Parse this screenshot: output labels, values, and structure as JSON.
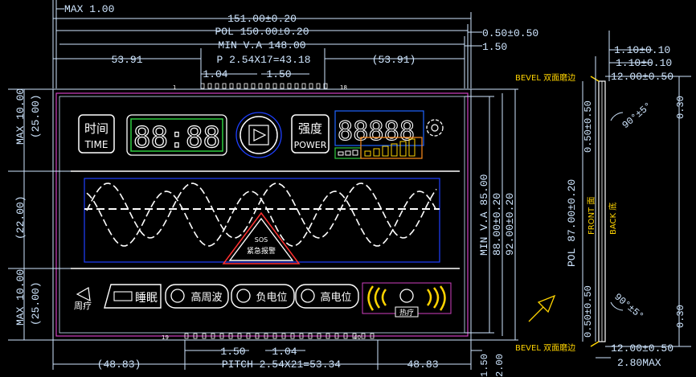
{
  "dimensions": {
    "max_top": "MAX 1.00",
    "total_width": "151.00±0.20",
    "pol_width": "POL 150.00±0.20",
    "min_va_width": "MIN V.A 148.00",
    "left_offset": "53.91",
    "pin_pitch_top": "P 2.54X17=43.18",
    "right_offset_top": "(53.91)",
    "pin_width_top": "1.04",
    "pin_gap_top": "1.50",
    "pol_right": "0.50±0.50",
    "va_right": "1.50",
    "left_max_top": "MAX 10.00",
    "left_25_top": "(25.00)",
    "left_22": "(22.00)",
    "left_max_bottom": "MAX 10.00",
    "left_25_bottom": "(25.00)",
    "right_min_va": "MIN V.A 85.00",
    "right_88": "88.00±0.20",
    "right_92": "92.00±0.20",
    "bottom_left_offset": "(48.83)",
    "bottom_pitch": "PITCH 2.54X21=53.34",
    "bottom_right_offset": "48.83",
    "bottom_gap": "1.50",
    "bottom_pin_width": "1.04",
    "bottom_v1": "1.50",
    "bottom_v2": "2.00"
  },
  "pins": {
    "first_top": "1",
    "last_top": "18",
    "first_bottom": "19",
    "last_bottom": "40"
  },
  "display": {
    "time_cn": "时间",
    "time_en": "TIME",
    "clock": "88:88",
    "power_cn": "强度",
    "power_en": "POWER",
    "power_digits": "88888",
    "sos_line1": "SOS",
    "sos_line2": "紧急报警",
    "mode_left": "周疗",
    "btn_sleep": "睡眠",
    "btn_high_freq": "高周波",
    "btn_neg": "负电位",
    "btn_high_pot": "高电位",
    "mode_right": "热疗"
  },
  "side_view": {
    "top_a": "1.10±0.10",
    "top_b": "1.10±0.10",
    "bevel_top": "BEVEL 双面磨边",
    "bevel_top_dim": "12.00±0.50",
    "angle_top": "90°±5°",
    "right_top": "0.30",
    "left_top": "0.50±0.50",
    "pol_height": "POL 87.00±0.20",
    "front": "FRONT 面",
    "back": "BACK 底",
    "left_bottom": "0.50±0.50",
    "angle_bottom": "90°±5°",
    "right_bottom": "0.30",
    "bevel_bottom": "BEVEL 双面磨边",
    "bevel_bottom_dim": "12.00±0.50",
    "thickness": "2.80MAX"
  },
  "colors": {
    "dim_line": "#cfe6ff",
    "segment": "#ffffff",
    "clock_box": "#2ecc40",
    "power_box": "#1e64ff",
    "bar_box": "#ff8c1a",
    "sos_outer": "#ff3030",
    "frame_magenta": "#d040c0",
    "bevel_label": "#ffd400"
  }
}
